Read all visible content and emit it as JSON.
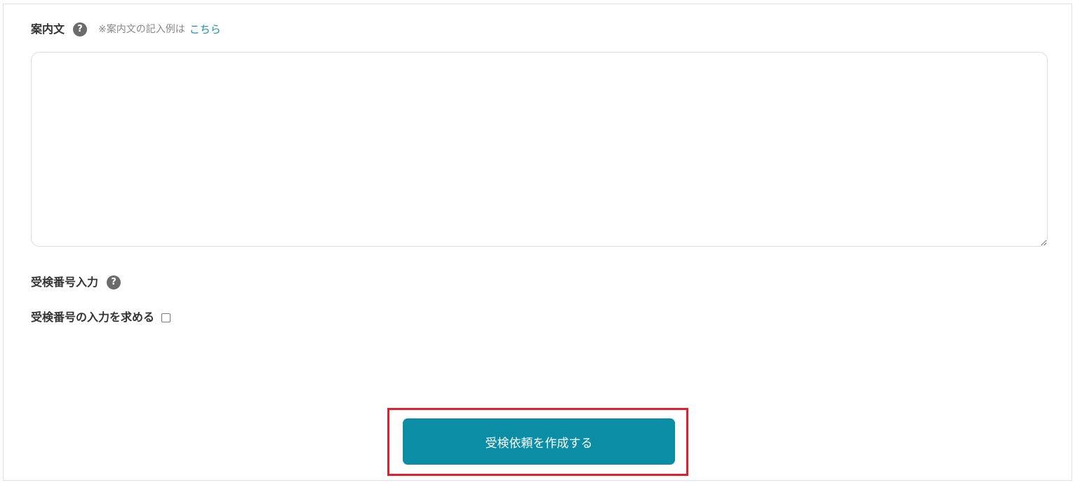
{
  "guidance": {
    "label": "案内文",
    "help_icon": "?",
    "note": "※案内文の記入例は",
    "link": "こちら",
    "textarea_value": ""
  },
  "exam_number": {
    "label": "受検番号入力",
    "help_icon": "?",
    "checkbox_label": "受検番号の入力を求める",
    "checkbox_checked": false
  },
  "actions": {
    "submit_label": "受検依頼を作成する"
  },
  "colors": {
    "accent": "#0b8ea5",
    "link": "#1a90a8",
    "highlight": "#e0202a",
    "help_icon_bg": "#6b6b6b"
  },
  "icons": {
    "help": "question-circle-icon",
    "resize": "resize-handle-icon"
  }
}
